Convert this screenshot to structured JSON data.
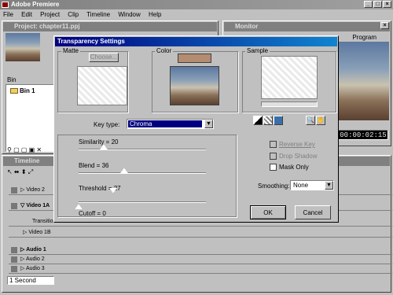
{
  "app": {
    "title": "Adobe Premiere"
  },
  "menu": [
    "File",
    "Edit",
    "Project",
    "Clip",
    "Timeline",
    "Window",
    "Help"
  ],
  "project": {
    "title": "Project: chapter11.ppj",
    "bin_header": "Bin",
    "bin_item": "Bin 1"
  },
  "monitor": {
    "title": "Monitor",
    "program_label": "Program",
    "timecode": "00:00:02:15"
  },
  "timeline": {
    "title": "Timeline",
    "tracks": [
      "Video 2",
      "Video 1A",
      "Transition",
      "Video 1B",
      "Audio 1",
      "Audio 2",
      "Audio 3"
    ],
    "duration_select": "1 Second"
  },
  "dialog": {
    "title": "Transparency Settings",
    "matte_label": "Matte",
    "choose_label": "Choose...",
    "color_label": "Color",
    "sample_label": "Sample",
    "key_type_label": "Key type:",
    "key_type_value": "Chroma",
    "similarity": {
      "label": "Similarity = 20",
      "value": 20,
      "max": 100
    },
    "blend": {
      "label": "Blend = 36",
      "value": 36,
      "max": 100
    },
    "threshold": {
      "label": "Threshold = 27",
      "value": 27,
      "max": 100
    },
    "cutoff": {
      "label": "Cutoff = 0",
      "value": 0,
      "max": 100
    },
    "reverse_key": "Reverse Key",
    "drop_shadow": "Drop Shadow",
    "mask_only": "Mask Only",
    "smoothing_label": "Smoothing:",
    "smoothing_value": "None",
    "ok_label": "OK",
    "cancel_label": "Cancel",
    "key_color": "#b38c72"
  }
}
